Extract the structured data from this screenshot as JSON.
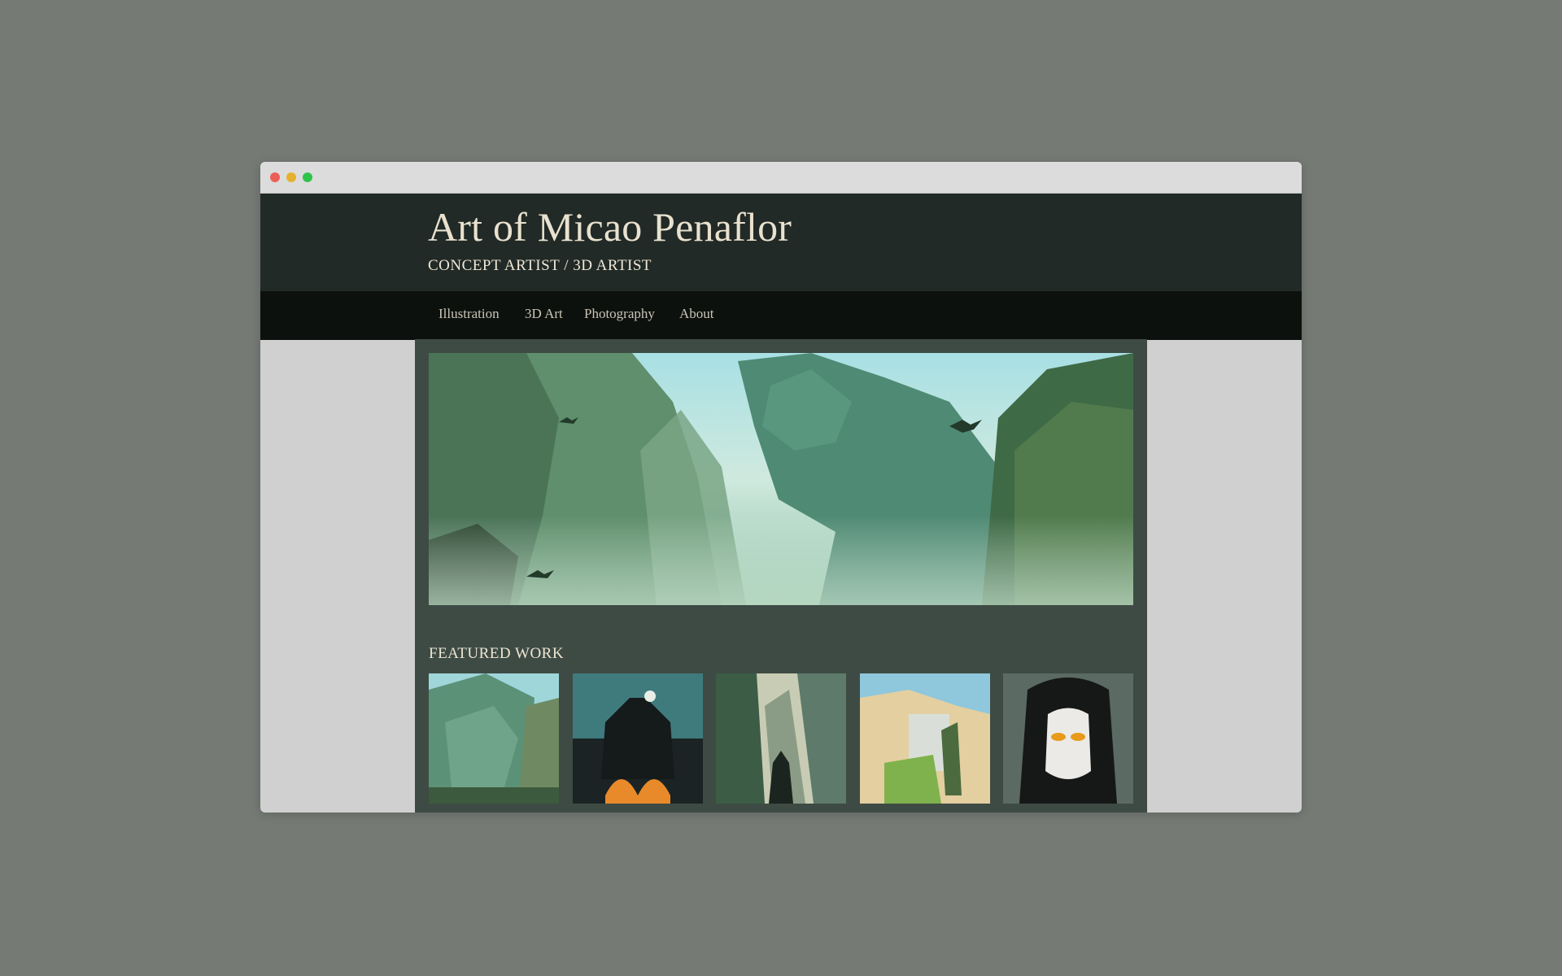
{
  "site": {
    "title": "Art of Micao Penaflor",
    "subtitle": "CONCEPT ARTIST / 3D ARTIST"
  },
  "nav": {
    "items": [
      "Illustration",
      "3D Art",
      "Photography",
      "About"
    ]
  },
  "featured": {
    "heading": "FEATURED WORK"
  },
  "colors": {
    "page_bg": "#757a75",
    "header_bg": "#212a26",
    "nav_bg": "#0d110e",
    "content_bg": "#3e4b44",
    "title_text": "#e9e1cf",
    "nav_text": "#c9c4b6"
  }
}
